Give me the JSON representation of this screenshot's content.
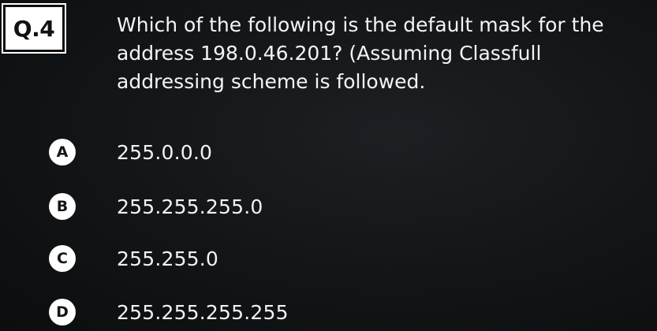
{
  "question": {
    "number": "Q.4",
    "text": "Which of the following is the default mask for the address 198.0.46.201? (Assuming Classfull addressing scheme is followed."
  },
  "options": [
    {
      "letter": "A",
      "text": "255.0.0.0"
    },
    {
      "letter": "B",
      "text": "255.255.255.0"
    },
    {
      "letter": "C",
      "text": "255.255.0"
    },
    {
      "letter": "D",
      "text": "255.255.255.255"
    }
  ]
}
